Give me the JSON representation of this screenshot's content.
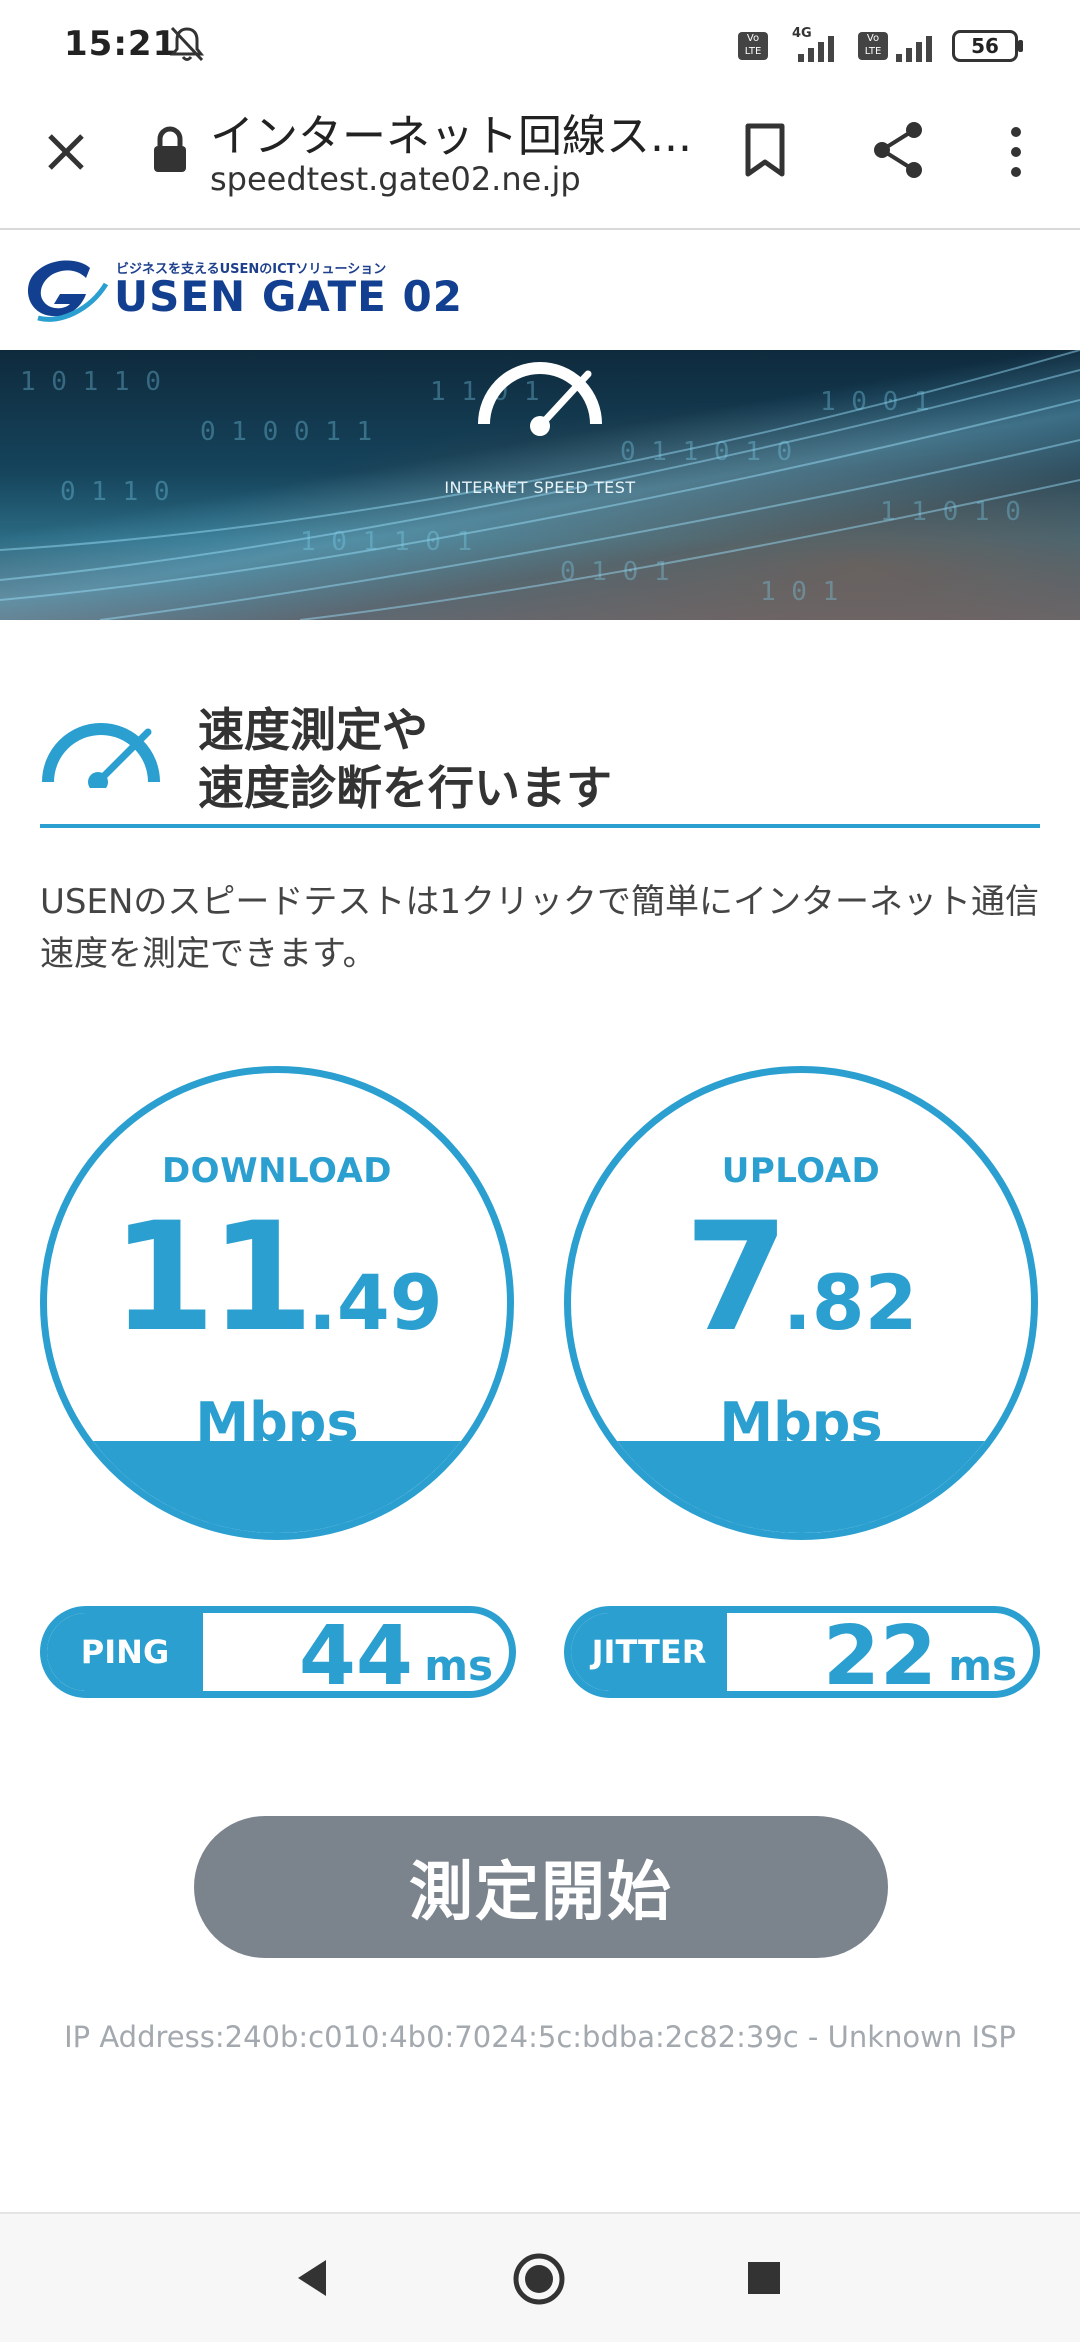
{
  "status_bar": {
    "time": "15:21",
    "network_type": "4G",
    "volte_1": "Vo LTE",
    "volte_2": "Vo LTE",
    "battery": "56",
    "icons": [
      "bell-off-icon",
      "signal-icon",
      "battery-icon"
    ]
  },
  "browser": {
    "page_title": "インターネット回線ス...",
    "url": "speedtest.gate02.ne.jp",
    "icons": [
      "close-icon",
      "lock-icon",
      "bookmark-icon",
      "share-icon",
      "more-vert-icon"
    ]
  },
  "site": {
    "tagline": "ビジネスを支えるUSENのICTソリューション",
    "brand": "USEN GATE 02",
    "hero_caption": "INTERNET SPEED TEST",
    "heading_line1": "速度測定や",
    "heading_line2": "速度診断を行います",
    "description": "USENのスピードテストは1クリックで簡単にインターネット通信速度を測定できます。"
  },
  "results": {
    "download": {
      "label": "DOWNLOAD",
      "int": "11",
      "dec": ".49",
      "unit": "Mbps",
      "fill_fraction": 0.2
    },
    "upload": {
      "label": "UPLOAD",
      "int": "7",
      "dec": ".82",
      "unit": "Mbps",
      "fill_fraction": 0.2
    },
    "ping": {
      "label": "PING",
      "value": "44",
      "unit": "ms"
    },
    "jitter": {
      "label": "JITTER",
      "value": "22",
      "unit": "ms"
    }
  },
  "start_button": "測定開始",
  "ip_info": "IP Address:240b:c010:4b0:7024:5c:bdba:2c82:39c - Unknown ISP",
  "colors": {
    "accent": "#2a9fd0",
    "button": "#7b848d",
    "brand": "#123f8f"
  },
  "nav_bar": {
    "icons": [
      "back-icon",
      "home-icon",
      "recents-icon"
    ]
  }
}
